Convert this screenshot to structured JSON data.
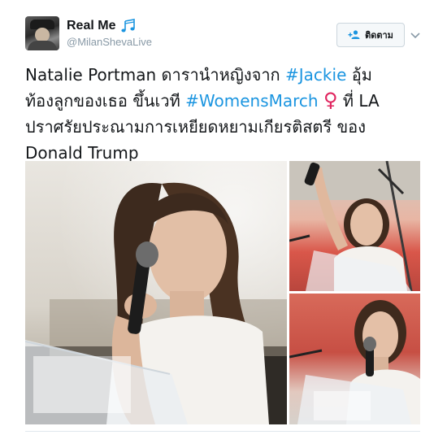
{
  "user": {
    "display_name": "Real Me",
    "handle": "@MilanShevaLive",
    "emoji_icon": "music-notes-icon"
  },
  "follow_button": {
    "label": "ติดตาม",
    "icon": "add-user-icon"
  },
  "menu_icon": "chevron-down-icon",
  "tweet": {
    "line1_text": "Natalie Portman ดารานำหญิงจาก ",
    "hashtag1": "#Jackie",
    "line1_tail": " อุ้ม",
    "line2_text": "ท้องลูกของเธอ ขึ้นเวที ",
    "hashtag2": "#WomensMarch",
    "female_symbol": "♀",
    "line2_tail": " ที่ LA",
    "line3": "ปราศรัยประณามการเหยียดหยามเกียรติสตรี ของ",
    "line4": "Donald Trump"
  },
  "colors": {
    "link": "#1b95e0",
    "female_symbol": "#e0245e",
    "text": "#14171a",
    "muted": "#8899a6"
  },
  "media": {
    "count": 3,
    "photos": [
      "photo-main",
      "photo-top-right",
      "photo-bottom-right"
    ]
  }
}
